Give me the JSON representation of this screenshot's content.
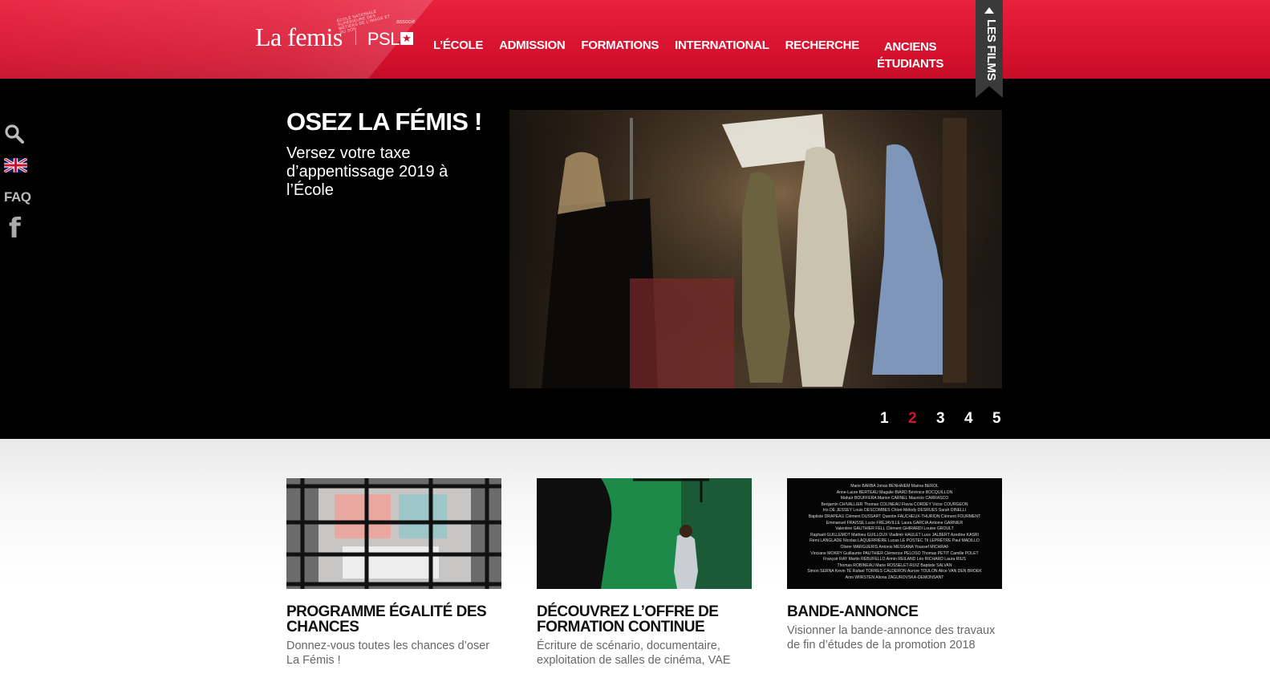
{
  "header": {
    "logo_text": "La femis",
    "logo_tagline": "École nationale supérieure des métiers de l'image et du son",
    "logo_assoc": "associé",
    "logo_psl": "PSL",
    "nav": [
      "L’ÉCOLE",
      "ADMISSION",
      "FORMATIONS",
      "INTERNATIONAL",
      "RECHERCHE"
    ],
    "nav_anciens_line1": "ANCIENS",
    "nav_anciens_line2": "ÉTUDIANTS",
    "films_tab": "LES FILMS"
  },
  "sidebar": {
    "faq": "FAQ",
    "facebook": "f",
    "icons": [
      "search-icon",
      "uk-flag-icon",
      "facebook-icon"
    ]
  },
  "hero": {
    "title": "OSEZ LA FÉMIS !",
    "subtitle": "Versez votre taxe d’appentissage 2019 à l’École",
    "pages": [
      "1",
      "2",
      "3",
      "4",
      "5"
    ],
    "active_page": "2"
  },
  "cards": [
    {
      "title": "PROGRAMME ÉGALITÉ DES CHANCES",
      "desc": "Donnez-vous toutes les chances d’oser La Fémis !"
    },
    {
      "title": "DÉCOUVREZ L’OFFRE DE FORMATION CONTINUE",
      "desc": "Écriture de scénario, documentaire, exploitation de salles de cinéma, VAE"
    },
    {
      "title": "BANDE-ANNONCE",
      "desc": "Visionner la bande-annonce des travaux de fin d’études de la promotion 2018"
    }
  ],
  "credits": [
    "Marie BARBA  Jonas BENHAIEM Maëva BEROL",
    "Anne-Laure BERTEAU Magalie BIARD Bérénice BOCQUILLON",
    "Mahaïr BOUFFERA Marion CARNEL Mauricio CARRASCO",
    "Benjamin CHIVALLIER Thomas COLINEAU Flavia CORDEY Victor COURGEON",
    "Iris DE JESSEY Louis DESCOMBES Chloé-Mélody DESRUES Sarah DINELLI",
    "Baptiste DRAPEAU Clément DUSSART Quentin FAUCHEUX-THURION Clément FOURMENT",
    "Emmanuel FRAISSE Lucie FRÉJAVILLE Laura GARCIA Antoine GARNIER",
    "Valentine GAUTHIER FELL Clément GHIRARDI Louise GROULT",
    "Raphaël GUILLEMOT Mathieu GUILLOUX Vladimir HAULET Luce JALBERT Azedine KASRI",
    "Rémi LANGLADE Nicolas LAQUERRIÈRE Lucas LE POSTEC Til LEPRÊTRE Paul MADILLO",
    "Olivier MARGUERIS Antonio MESSANA Youssef MICHRAF",
    "Vinciane MOKRY Guillaume PAUTHIER Clémence PELOSO Thomas PETIT Camille POLET",
    "Françoir RAY Martin REBUFELLO Armin REILAND Léo RICHARD Laura RIUS",
    "Thomas ROBINEAU Marie ROSSELET-RUIZ Baptiste SALVAN",
    "Simon SERNA Kevin TÉ Rafael TORRES CALDERON Aurore TOULON Alice VAN DEN BROEK",
    "Anni WIIRSTEN Aliona ZAGUROVSKA-DEMONSANT"
  ]
}
